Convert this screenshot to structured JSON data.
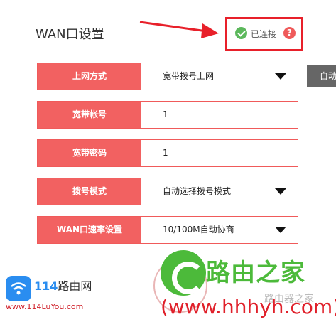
{
  "page": {
    "title": "WAN口设置"
  },
  "status": {
    "text": "已连接",
    "help_symbol": "?",
    "check_icon": "check-circle-icon",
    "help_icon": "question-circle-icon",
    "accent_color": "#e8202a"
  },
  "form": {
    "rows": [
      {
        "label": "上网方式",
        "value": "宽带拨号上网",
        "dropdown": true
      },
      {
        "label": "宽带帐号",
        "value": "1",
        "dropdown": false
      },
      {
        "label": "宽带密码",
        "value": "1",
        "dropdown": false
      },
      {
        "label": "拨号模式",
        "value": "自动选择拨号模式",
        "dropdown": true
      },
      {
        "label": "WAN口速率设置",
        "value": "10/100M自动协商",
        "dropdown": true
      }
    ],
    "label_color": "#f26161"
  },
  "side_button": {
    "label": "自动"
  },
  "watermarks": {
    "left_brand_number": "114",
    "left_brand_text": "路由网",
    "left_url": "www.114LuYou.com",
    "right_brand": "路由之家",
    "right_url": "(www.hhhyh.com)",
    "right_ghost": "路由器之家"
  }
}
